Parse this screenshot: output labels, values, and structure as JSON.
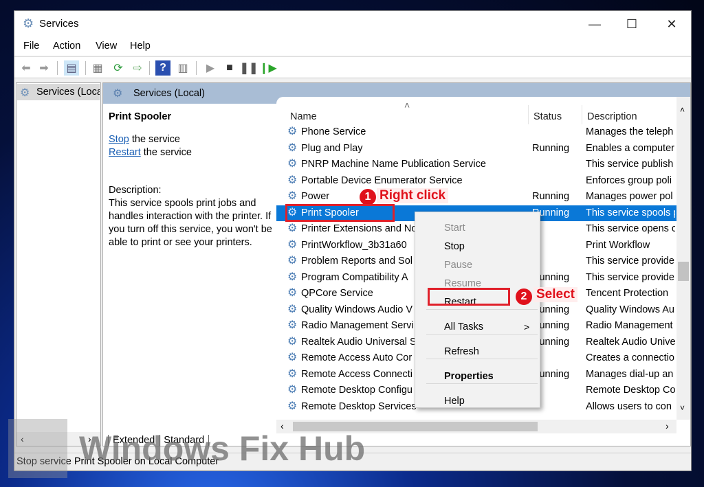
{
  "window": {
    "title": "Services",
    "icon": "gear-icon",
    "minimize": "—",
    "maximize": "☐",
    "close": "✕"
  },
  "menu": [
    "File",
    "Action",
    "View",
    "Help"
  ],
  "toolbar": {
    "icons": [
      "back-icon",
      "forward-icon",
      "show-hide-tree-icon",
      "properties-icon",
      "refresh-icon",
      "export-list-icon",
      "help-icon",
      "console-view-icon",
      "start-service-icon",
      "stop-service-icon",
      "pause-service-icon",
      "resume-service-icon"
    ]
  },
  "tree": {
    "item": "Services (Local)"
  },
  "panel": {
    "header": "Services (Local)",
    "service_name": "Print Spooler",
    "stop_link": "Stop",
    "stop_rest": " the service",
    "restart_link": "Restart",
    "restart_rest": " the service",
    "description_label": "Description:",
    "description": "This service spools print jobs and handles interaction with the printer. If you turn off this service, you won't be able to print or see your printers."
  },
  "columns": {
    "name": "Name",
    "status": "Status",
    "description": "Description"
  },
  "rows": [
    {
      "name": "Phone Service",
      "status": "",
      "description": "Manages the teleph"
    },
    {
      "name": "Plug and Play",
      "status": "Running",
      "description": "Enables a computer"
    },
    {
      "name": "PNRP Machine Name Publication Service",
      "status": "",
      "description": "This service publish"
    },
    {
      "name": "Portable Device Enumerator Service",
      "status": "",
      "description": "Enforces group poli"
    },
    {
      "name": "Power",
      "status": "Running",
      "description": "Manages power pol"
    },
    {
      "name": "Print Spooler",
      "status": "Running",
      "description": "This service spools p"
    },
    {
      "name": "Printer Extensions and No",
      "status": "",
      "description": "This service opens c"
    },
    {
      "name": "PrintWorkflow_3b31a60",
      "status": "",
      "description": "Print Workflow"
    },
    {
      "name": "Problem Reports and Sol",
      "status": "",
      "description": "This service provide"
    },
    {
      "name": "Program Compatibility A",
      "status": "Running",
      "description": "This service provide"
    },
    {
      "name": "QPCore Service",
      "status": "",
      "description": "Tencent Protection"
    },
    {
      "name": "Quality Windows Audio V",
      "status": "Running",
      "description": "Quality Windows Au"
    },
    {
      "name": "Radio Management Servi",
      "status": "Running",
      "description": "Radio Management"
    },
    {
      "name": "Realtek Audio Universal S",
      "status": "Running",
      "description": "Realtek Audio Unive"
    },
    {
      "name": "Remote Access Auto Cor",
      "status": "",
      "description": "Creates a connectio"
    },
    {
      "name": "Remote Access Connecti",
      "status": "Running",
      "description": "Manages dial-up an"
    },
    {
      "name": "Remote Desktop Configu",
      "status": "",
      "description": "Remote Desktop Co"
    },
    {
      "name": "Remote Desktop Services",
      "status": "",
      "description": "Allows users to con"
    }
  ],
  "context_menu": [
    {
      "label": "Start",
      "disabled": true
    },
    {
      "label": "Stop",
      "disabled": false
    },
    {
      "label": "Pause",
      "disabled": true
    },
    {
      "label": "Resume",
      "disabled": true
    },
    {
      "label": "Restart",
      "disabled": false
    },
    {
      "label": "All Tasks",
      "disabled": false,
      "submenu": ">"
    },
    {
      "label": "Refresh",
      "disabled": false
    },
    {
      "label": "Properties",
      "disabled": false,
      "bold": true
    },
    {
      "label": "Help",
      "disabled": false
    }
  ],
  "annotations": {
    "step1_num": "1",
    "step1": "Right click",
    "step2_num": "2",
    "step2": "Select",
    "accent": "#e0111b"
  },
  "tabs": [
    "Extended",
    "Standard"
  ],
  "statusbar": "Stop service Print Spooler on Local Computer",
  "watermark": "Windows Fix Hub",
  "selection_color": "#0a78d7"
}
